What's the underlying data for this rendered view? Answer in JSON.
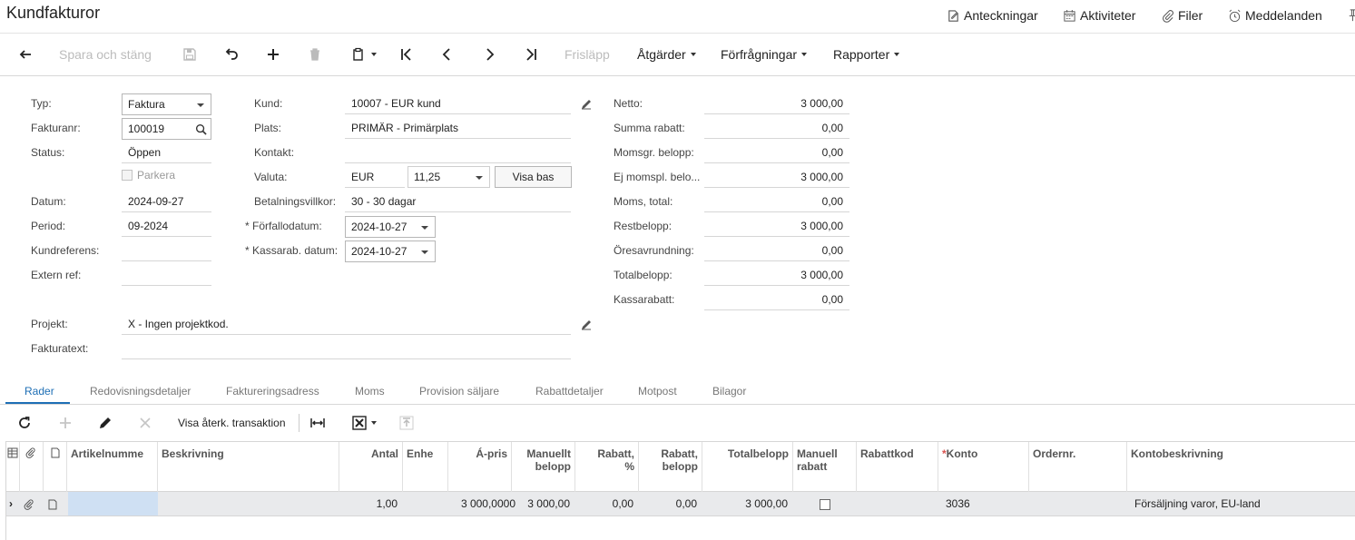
{
  "page": {
    "title": "Kundfakturor"
  },
  "header_links": {
    "notes": "Anteckningar",
    "activities": "Aktiviteter",
    "files": "Filer",
    "messages": "Meddelanden"
  },
  "toolbar": {
    "save_close": "Spara och stäng",
    "release": "Frisläpp",
    "actions": "Åtgärder",
    "inquiries": "Förfrågningar",
    "reports": "Rapporter"
  },
  "form": {
    "type_label": "Typ:",
    "type_value": "Faktura",
    "invoice_label": "Fakturanr:",
    "invoice_value": "100019",
    "status_label": "Status:",
    "status_value": "Öppen",
    "hold_label": "Parkera",
    "date_label": "Datum:",
    "date_value": "2024-09-27",
    "period_label": "Period:",
    "period_value": "09-2024",
    "custref_label": "Kundreferens:",
    "custref_value": "",
    "extref_label": "Extern ref:",
    "extref_value": "",
    "customer_label": "Kund:",
    "customer_value": "10007 - EUR kund",
    "location_label": "Plats:",
    "location_value": "PRIMÄR - Primärplats",
    "contact_label": "Kontakt:",
    "contact_value": "",
    "currency_label": "Valuta:",
    "currency_value": "EUR",
    "rate_value": "11,25",
    "view_base": "Visa bas",
    "terms_label": "Betalningsvillkor:",
    "terms_value": "30 - 30 dagar",
    "due_label": "Förfallodatum:",
    "due_value": "2024-10-27",
    "discdate_label": "Kassarab. datum:",
    "discdate_value": "2024-10-27",
    "project_label": "Projekt:",
    "project_value": "X - Ingen projektkod.",
    "invtext_label": "Fakturatext:",
    "invtext_value": "",
    "required_mark": "*"
  },
  "totals": [
    {
      "label": "Netto:",
      "value": "3 000,00"
    },
    {
      "label": "Summa rabatt:",
      "value": "0,00"
    },
    {
      "label": "Momsgr. belopp:",
      "value": "0,00"
    },
    {
      "label": "Ej momspl. belo...",
      "value": "3 000,00"
    },
    {
      "label": "Moms, total:",
      "value": "0,00"
    },
    {
      "label": "Restbelopp:",
      "value": "3 000,00"
    },
    {
      "label": "Öresavrundning:",
      "value": "0,00"
    },
    {
      "label": "Totalbelopp:",
      "value": "3 000,00"
    },
    {
      "label": "Kassarabatt:",
      "value": "0,00"
    }
  ],
  "tabs": [
    "Rader",
    "Redovisningsdetaljer",
    "Faktureringsadress",
    "Moms",
    "Provision säljare",
    "Rabattdetaljer",
    "Motpost",
    "Bilagor"
  ],
  "grid_toolbar": {
    "view_recurring": "Visa återk. transaktion"
  },
  "grid": {
    "columns": [
      "Artikelnummer",
      "Beskrivning",
      "Antal",
      "Enhet",
      "Á-pris",
      "Manuellt belopp",
      "Rabatt, %",
      "Rabatt, belopp",
      "Totalbelopp",
      "Manuell rabatt",
      "Rabattkod",
      "Konto",
      "Ordernr.",
      "Kontobeskrivning"
    ],
    "column_display": {
      "item": "Artikelnumme",
      "unit": "Enhe",
      "manual_amount_1": "Manuellt",
      "manual_amount_2": "belopp",
      "disc_pct_1": "Rabatt,",
      "disc_pct_2": "%",
      "disc_amt_1": "Rabatt,",
      "disc_amt_2": "belopp",
      "manual_disc_1": "Manuell",
      "manual_disc_2": "rabatt"
    },
    "rows": [
      {
        "item": "",
        "description": "",
        "qty": "1,00",
        "unit": "",
        "unit_price": "3 000,0000",
        "manual_amount": "3 000,00",
        "disc_pct": "0,00",
        "disc_amt": "0,00",
        "total": "3 000,00",
        "manual_discount": false,
        "disc_code": "",
        "account": "3036",
        "order_nbr": "",
        "account_desc": "Försäljning varor, EU-land"
      }
    ]
  },
  "colors": {
    "accent": "#1e6fb5",
    "selected_cell": "#cfe0f3",
    "row_bg": "#e9eaec",
    "required": "#d9534f"
  }
}
